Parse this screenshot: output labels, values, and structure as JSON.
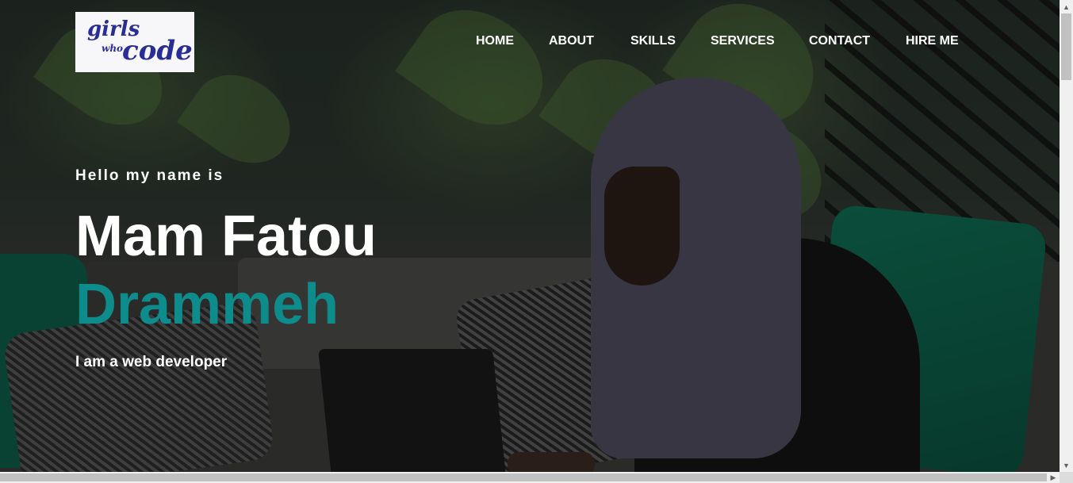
{
  "logo": {
    "words": [
      "girls",
      "who",
      "code"
    ]
  },
  "nav": {
    "items": [
      {
        "label": "HOME"
      },
      {
        "label": "ABOUT"
      },
      {
        "label": "SKILLS"
      },
      {
        "label": "SERVICES"
      },
      {
        "label": "CONTACT"
      },
      {
        "label": "HIRE ME"
      }
    ]
  },
  "hero": {
    "greeting": "Hello my name is",
    "first_name": "Mam Fatou",
    "last_name": "Drammeh",
    "tagline": "I am a web developer"
  },
  "colors": {
    "accent": "#0e8c8c",
    "text": "#ffffff",
    "logo_blue": "#2b2d96"
  },
  "icons": {
    "scroll_up": "triangle-up",
    "scroll_down": "triangle-down",
    "scroll_right": "triangle-right"
  }
}
